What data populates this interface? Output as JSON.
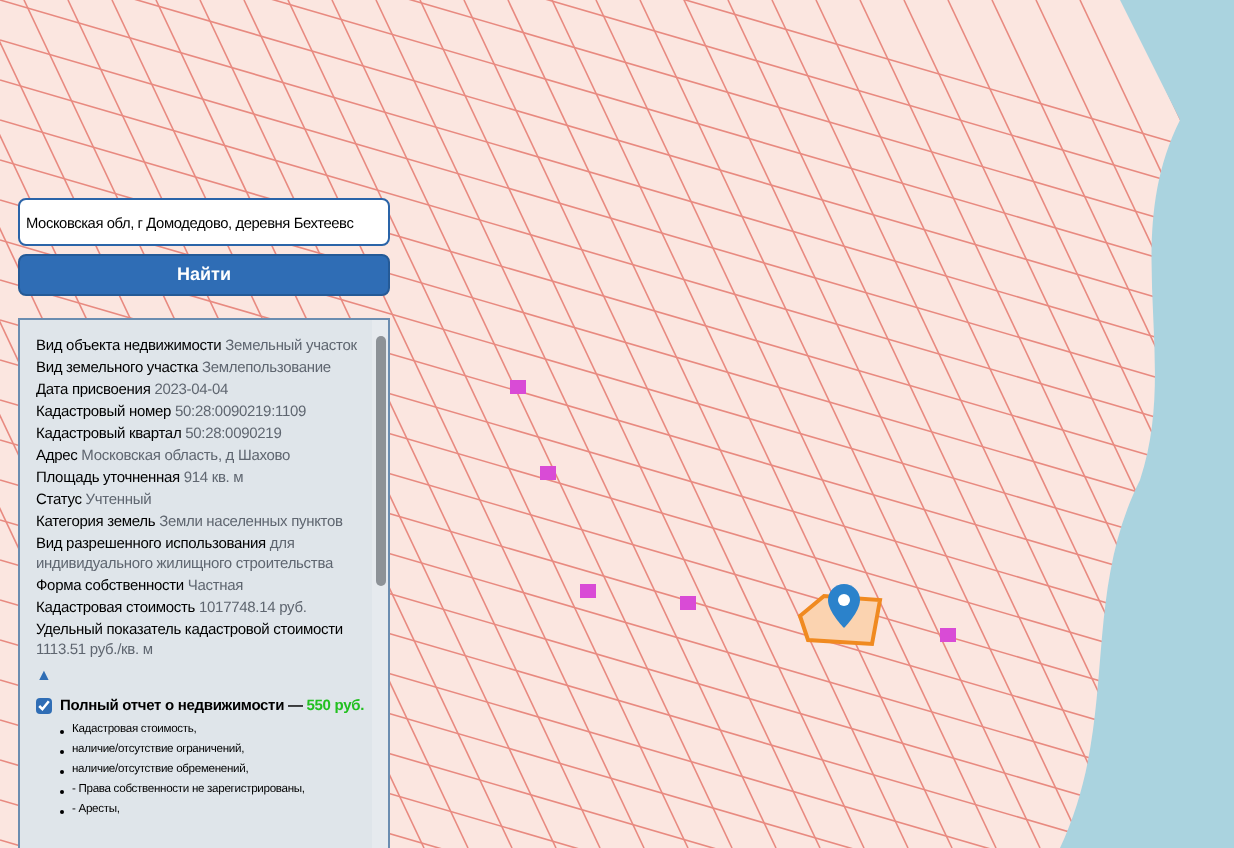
{
  "search": {
    "value": "Московская обл, г Домодедово, деревня Бехтеевс"
  },
  "search_button": "Найти",
  "info": {
    "fields": [
      {
        "label": "Вид объекта недвижимости",
        "value": "Земельный участок"
      },
      {
        "label": "Вид земельного участка",
        "value": "Землепользование"
      },
      {
        "label": "Дата присвоения",
        "value": "2023-04-04"
      },
      {
        "label": "Кадастровый номер",
        "value": "50:28:0090219:1109"
      },
      {
        "label": "Кадастровый квартал",
        "value": "50:28:0090219"
      },
      {
        "label": "Адрес",
        "value": "Московская область, д Шахово"
      },
      {
        "label": "Площадь уточненная",
        "value": "914 кв. м"
      },
      {
        "label": "Статус",
        "value": "Учтенный"
      },
      {
        "label": "Категория земель",
        "value": "Земли населенных пунктов"
      },
      {
        "label": "Вид разрешенного использования",
        "value": "для индивидуального жилищного строительства"
      },
      {
        "label": "Форма собственности",
        "value": "Частная"
      },
      {
        "label": "Кадастровая стоимость",
        "value": "1017748.14 руб."
      },
      {
        "label": "Удельный показатель кадастровой стоимости",
        "value": "1113.51 руб./кв. м"
      }
    ],
    "collapse": "▲",
    "report": {
      "checked": true,
      "title": "Полный отчет о недвижимости — ",
      "price": "550 руб.",
      "items": [
        "Кадастровая стоимость,",
        "наличие/отсутствие ограничений,",
        "наличие/отсутствие обременений,",
        "- Права собственности не зарегистрированы,",
        "- Аресты,"
      ]
    }
  }
}
